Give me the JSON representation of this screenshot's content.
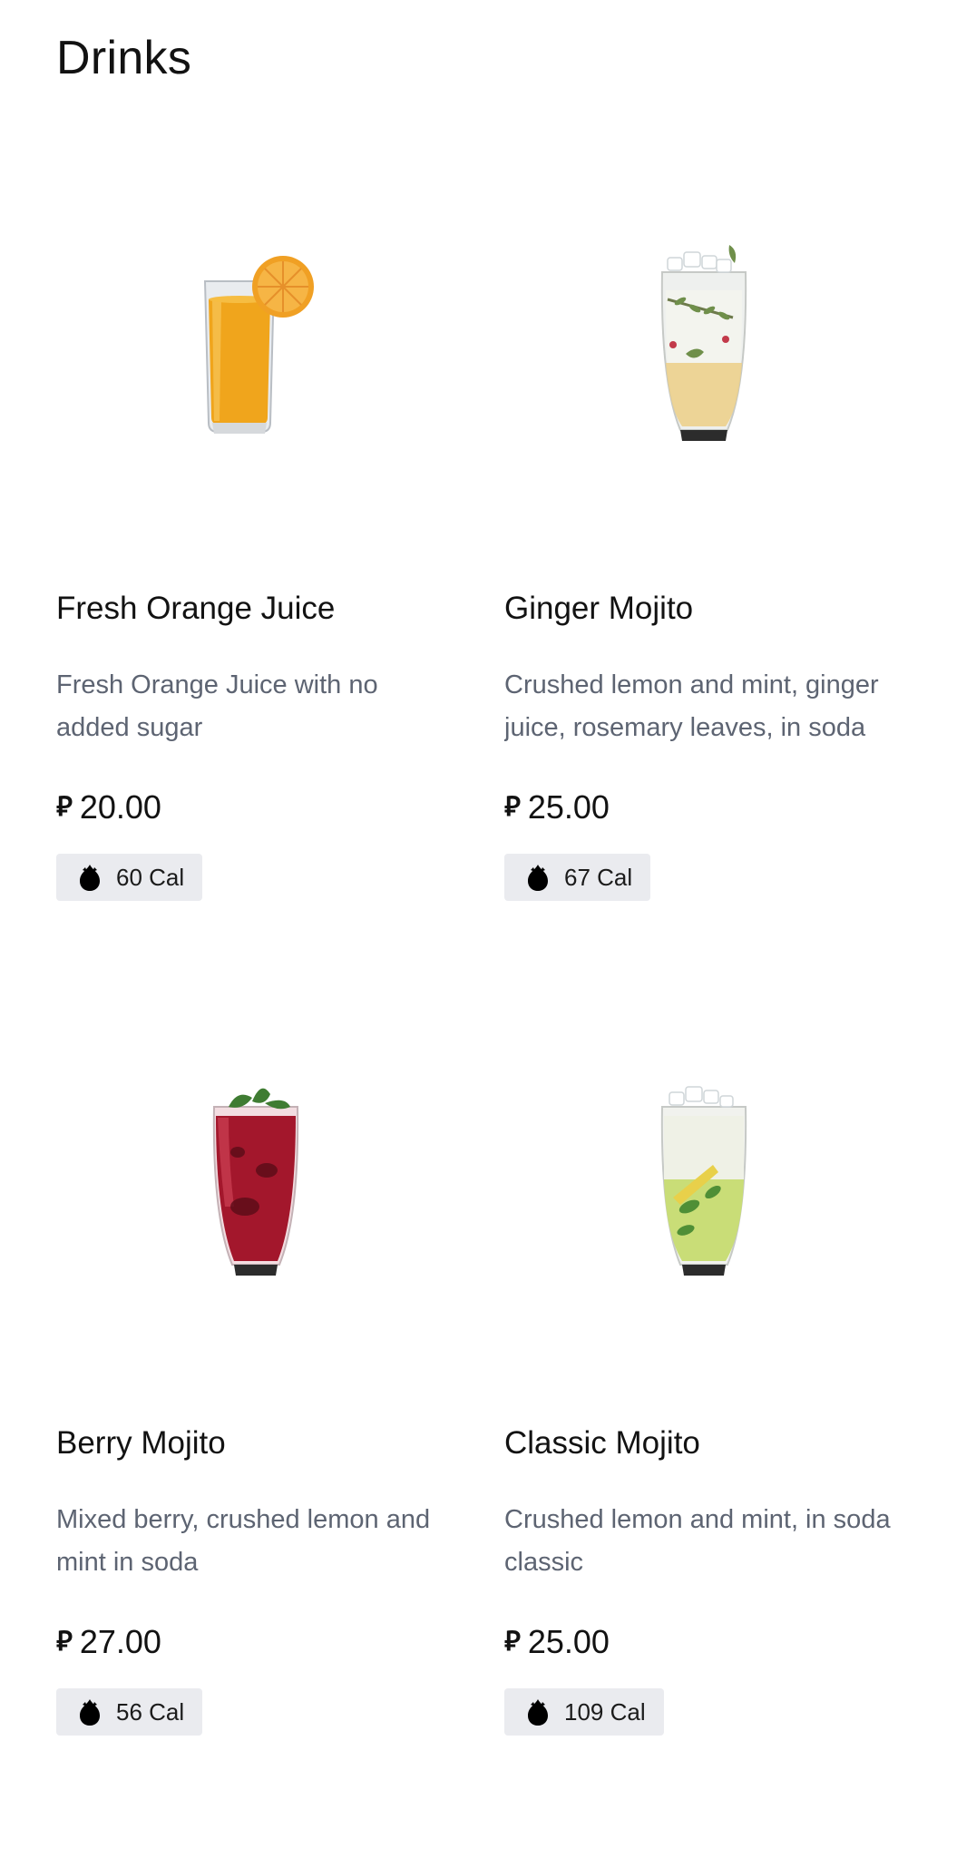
{
  "section": {
    "title": "Drinks"
  },
  "currency_symbol": "⃁",
  "items": [
    {
      "name": "Fresh Orange Juice",
      "description": "Fresh Orange Juice with no added sugar",
      "price": "20.00",
      "calories": "60 Cal",
      "image_icon": "orange-juice-glass-icon",
      "liquid_color": "#f0a51c"
    },
    {
      "name": "Ginger Mojito",
      "description": "Crushed lemon and mint, ginger juice, rosemary leaves, in soda",
      "price": "25.00",
      "calories": "67 Cal",
      "image_icon": "ginger-mojito-glass-icon",
      "liquid_color": "#efe6c4"
    },
    {
      "name": "Berry Mojito",
      "description": "Mixed berry, crushed lemon and mint in soda",
      "price": "27.00",
      "calories": "56 Cal",
      "image_icon": "berry-mojito-glass-icon",
      "liquid_color": "#a3172c"
    },
    {
      "name": "Classic Mojito",
      "description": "Crushed lemon and mint, in soda classic",
      "price": "25.00",
      "calories": "109 Cal",
      "image_icon": "classic-mojito-glass-icon",
      "liquid_color": "#c9dd77"
    }
  ]
}
